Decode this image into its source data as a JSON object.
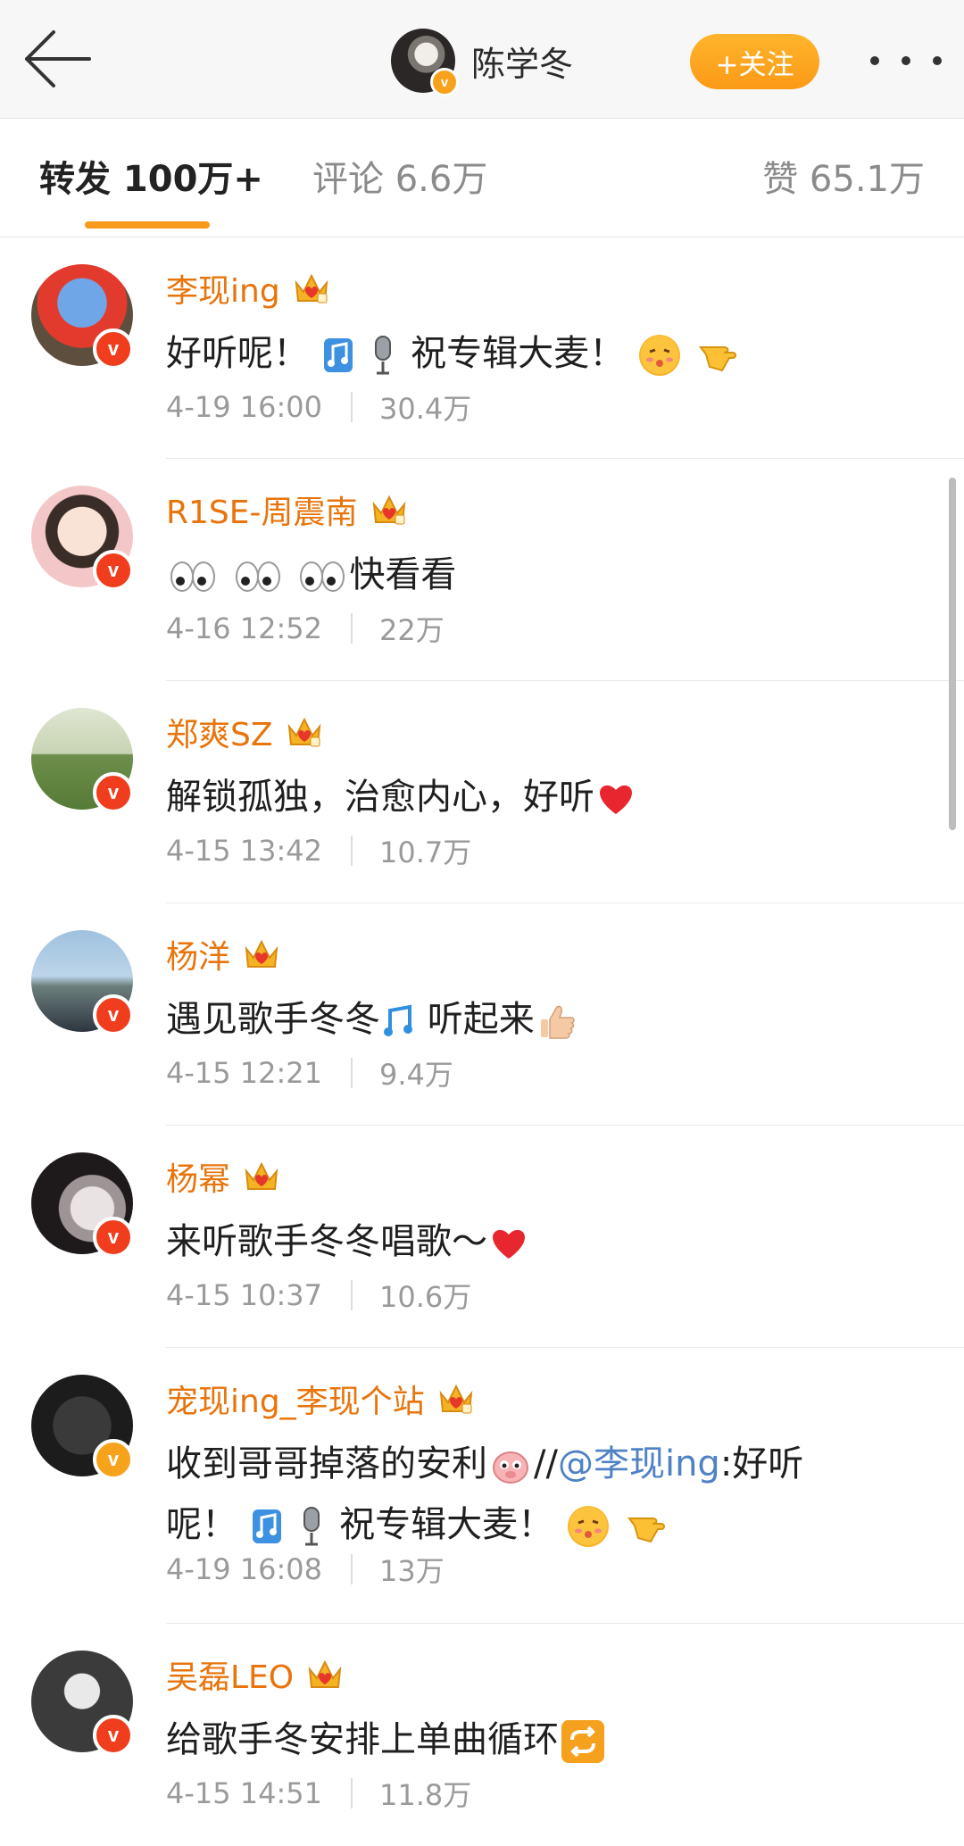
{
  "header": {
    "back_icon": "arrow-left-icon",
    "author_name": "陈学冬",
    "author_badge": "v",
    "follow_label": "+关注",
    "more_icon": "more-icon"
  },
  "tabs": {
    "repost": "转发 100万+",
    "comment": "评论 6.6万",
    "like": "赞 65.1万",
    "active_color": "#f99a1a"
  },
  "reposts": [
    {
      "name": "李现ing",
      "text_a": "好听呢！",
      "text_b": "祝专辑大麦！",
      "time": "4-19 16:00",
      "count": "30.4万"
    },
    {
      "name": "R1SE-周震南",
      "text_a": "快看看",
      "time": "4-16 12:52",
      "count": "22万"
    },
    {
      "name": "郑爽SZ",
      "text_a": "解锁孤独，治愈内心，好听",
      "time": "4-15 13:42",
      "count": "10.7万"
    },
    {
      "name": "杨洋",
      "text_a": "遇见歌手冬冬",
      "text_b": "听起来",
      "time": "4-15 12:21",
      "count": "9.4万"
    },
    {
      "name": "杨幂",
      "text_a": "来听歌手冬冬唱歌～",
      "time": "4-15 10:37",
      "count": "10.6万"
    },
    {
      "name": "宠现ing_李现个站",
      "text_a": "收到哥哥掉落的安利",
      "text_b": "//",
      "mention": "@李现ing",
      "text_c": ":好听",
      "text_d": "呢！",
      "text_e": "祝专辑大麦！",
      "time": "4-19 16:08",
      "count": "13万"
    },
    {
      "name": "吴磊LEO",
      "text_a": "给歌手冬安排上单曲循环",
      "time": "4-15 14:51",
      "count": "11.8万"
    }
  ],
  "colors": {
    "name_orange": "#e8740b",
    "mention_blue": "#4f82c4",
    "v_badge_orange": "#f6a21b"
  }
}
